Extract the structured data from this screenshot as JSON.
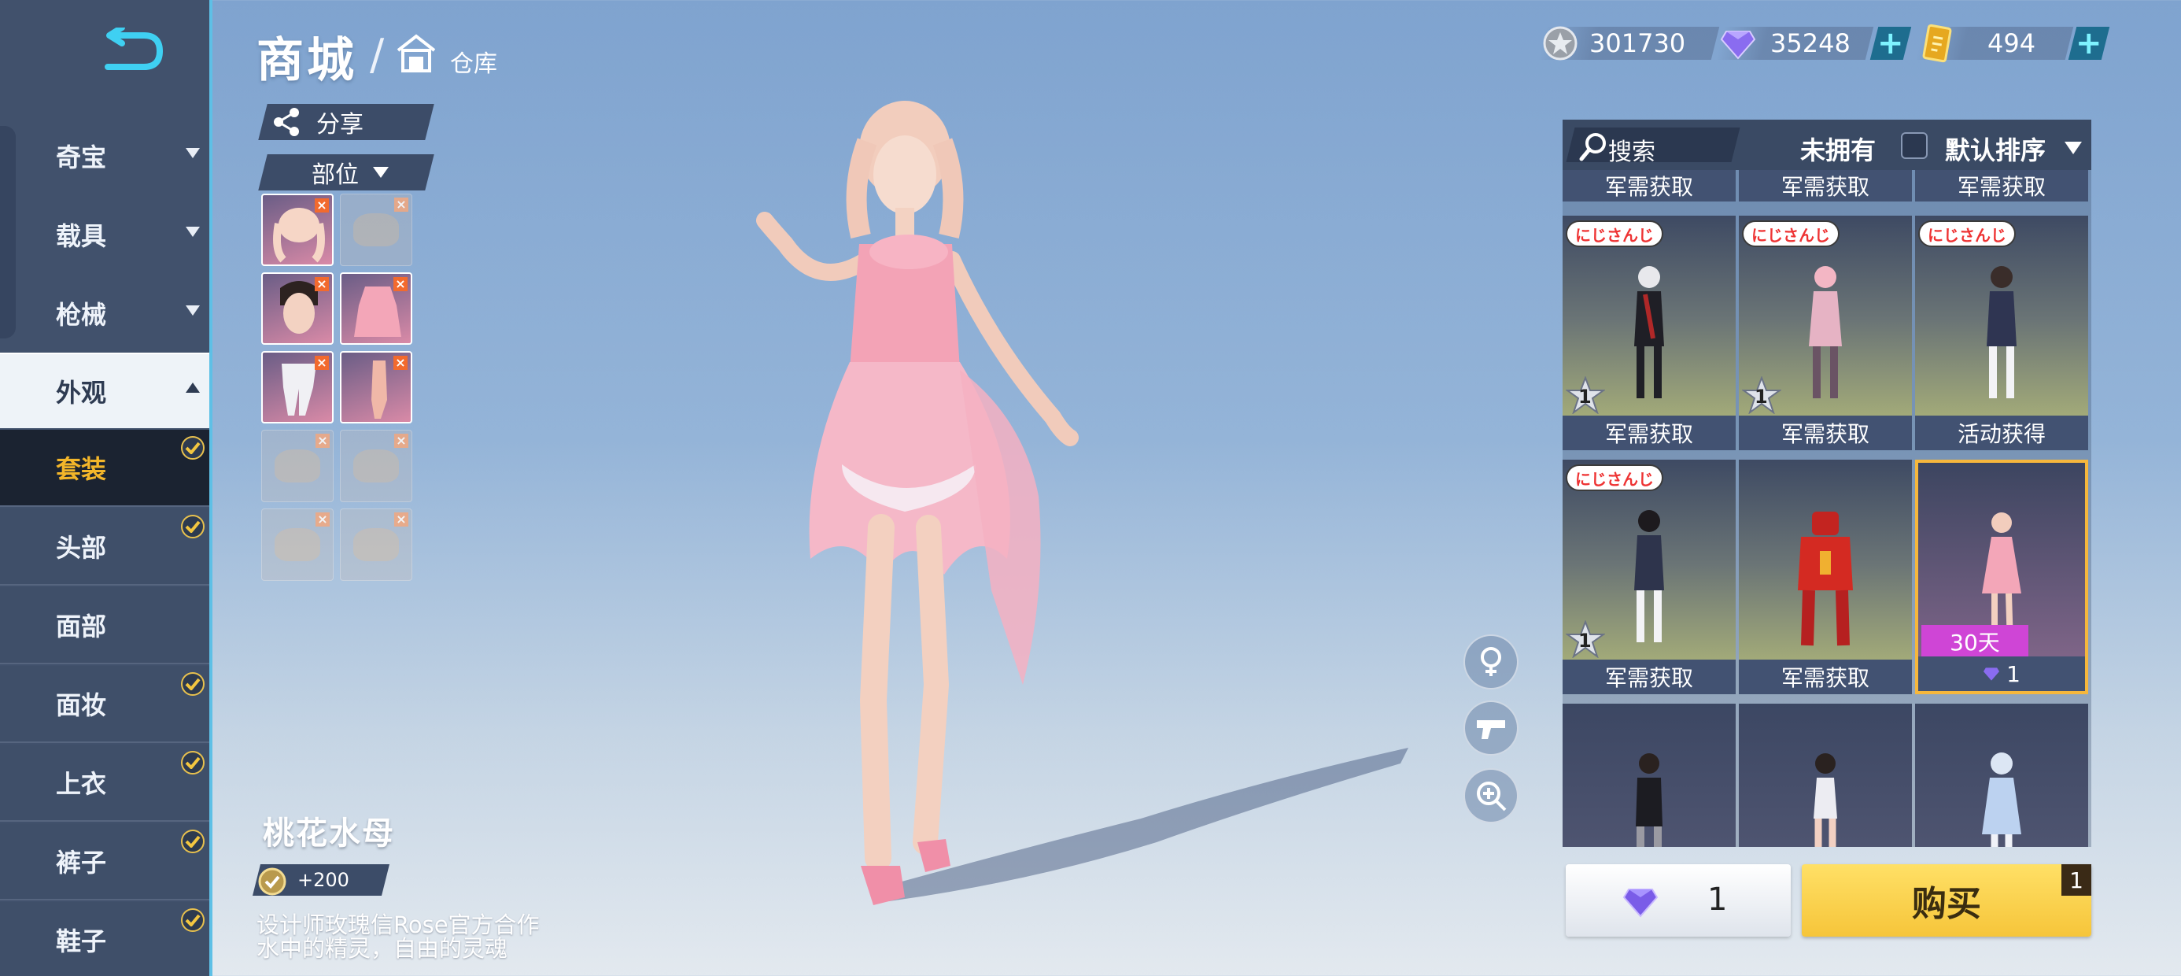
{
  "header": {
    "title": "商城",
    "slash": "/",
    "breadcrumb": "仓库"
  },
  "currency": [
    {
      "icon": "silver-coin-icon",
      "value": "301730"
    },
    {
      "icon": "diamond-icon",
      "value": "35248"
    },
    {
      "icon": "gold-ticket-icon",
      "value": "494"
    }
  ],
  "plus_label": "+",
  "sidebar": {
    "categories": [
      {
        "label": "奇宝"
      },
      {
        "label": "载具"
      },
      {
        "label": "枪械"
      },
      {
        "label": "外观"
      }
    ],
    "subitems": [
      {
        "label": "套装",
        "checked": true
      },
      {
        "label": "头部",
        "checked": true
      },
      {
        "label": "面部",
        "checked": false
      },
      {
        "label": "面妆",
        "checked": true
      },
      {
        "label": "上衣",
        "checked": true
      },
      {
        "label": "裤子",
        "checked": true
      },
      {
        "label": "鞋子",
        "checked": true
      }
    ]
  },
  "left_tools": {
    "share_label": "分享",
    "part_label": "部位"
  },
  "item": {
    "name": "桃花水母",
    "score": "+200",
    "desc_line1": "设计师玫瑰信Rose官方合作",
    "desc_line2": "水中的精灵，自由的灵魂"
  },
  "shop": {
    "search_label": "搜索",
    "unowned_label": "未拥有",
    "sort_label": "默认排序",
    "top_row": [
      "军需获取",
      "军需获取",
      "军需获取"
    ],
    "logo_text": "にじさんじ",
    "tiles": [
      {
        "footer": "军需获取",
        "star": "1"
      },
      {
        "footer": "军需获取",
        "star": "1"
      },
      {
        "footer": "活动获得"
      },
      {
        "footer": "军需获取",
        "star": "1"
      },
      {
        "footer": "军需获取"
      },
      {
        "footer": "1",
        "days": "30天"
      }
    ]
  },
  "purchase": {
    "price": "1",
    "buy_label": "购买",
    "cart_count": "1"
  },
  "colors": {
    "accent": "#5ec0e6",
    "selected_text": "#f3b62a",
    "buy_button": "#f6c53a",
    "days_badge": "#cf45d6"
  }
}
